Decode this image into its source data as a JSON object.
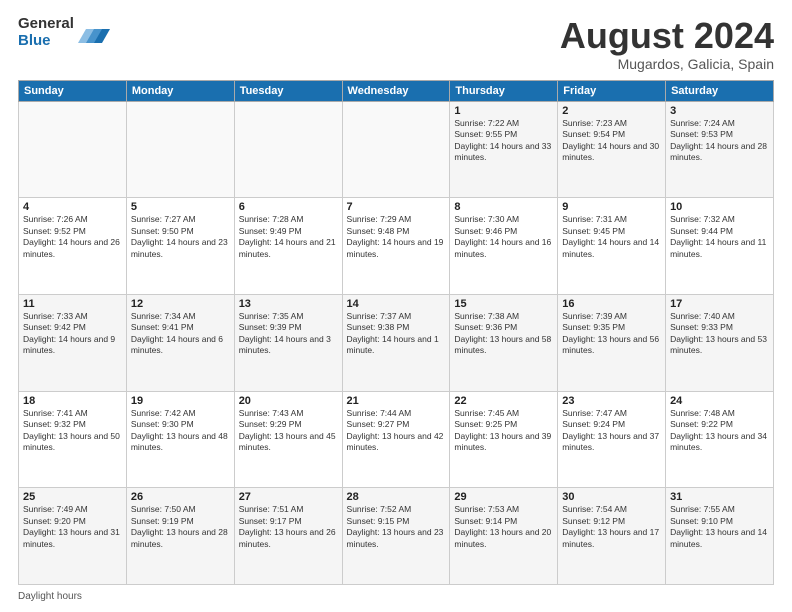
{
  "logo": {
    "general": "General",
    "blue": "Blue"
  },
  "title": "August 2024",
  "subtitle": "Mugardos, Galicia, Spain",
  "weekdays": [
    "Sunday",
    "Monday",
    "Tuesday",
    "Wednesday",
    "Thursday",
    "Friday",
    "Saturday"
  ],
  "weeks": [
    [
      {
        "day": "",
        "info": ""
      },
      {
        "day": "",
        "info": ""
      },
      {
        "day": "",
        "info": ""
      },
      {
        "day": "",
        "info": ""
      },
      {
        "day": "1",
        "info": "Sunrise: 7:22 AM\nSunset: 9:55 PM\nDaylight: 14 hours and 33 minutes."
      },
      {
        "day": "2",
        "info": "Sunrise: 7:23 AM\nSunset: 9:54 PM\nDaylight: 14 hours and 30 minutes."
      },
      {
        "day": "3",
        "info": "Sunrise: 7:24 AM\nSunset: 9:53 PM\nDaylight: 14 hours and 28 minutes."
      }
    ],
    [
      {
        "day": "4",
        "info": "Sunrise: 7:26 AM\nSunset: 9:52 PM\nDaylight: 14 hours and 26 minutes."
      },
      {
        "day": "5",
        "info": "Sunrise: 7:27 AM\nSunset: 9:50 PM\nDaylight: 14 hours and 23 minutes."
      },
      {
        "day": "6",
        "info": "Sunrise: 7:28 AM\nSunset: 9:49 PM\nDaylight: 14 hours and 21 minutes."
      },
      {
        "day": "7",
        "info": "Sunrise: 7:29 AM\nSunset: 9:48 PM\nDaylight: 14 hours and 19 minutes."
      },
      {
        "day": "8",
        "info": "Sunrise: 7:30 AM\nSunset: 9:46 PM\nDaylight: 14 hours and 16 minutes."
      },
      {
        "day": "9",
        "info": "Sunrise: 7:31 AM\nSunset: 9:45 PM\nDaylight: 14 hours and 14 minutes."
      },
      {
        "day": "10",
        "info": "Sunrise: 7:32 AM\nSunset: 9:44 PM\nDaylight: 14 hours and 11 minutes."
      }
    ],
    [
      {
        "day": "11",
        "info": "Sunrise: 7:33 AM\nSunset: 9:42 PM\nDaylight: 14 hours and 9 minutes."
      },
      {
        "day": "12",
        "info": "Sunrise: 7:34 AM\nSunset: 9:41 PM\nDaylight: 14 hours and 6 minutes."
      },
      {
        "day": "13",
        "info": "Sunrise: 7:35 AM\nSunset: 9:39 PM\nDaylight: 14 hours and 3 minutes."
      },
      {
        "day": "14",
        "info": "Sunrise: 7:37 AM\nSunset: 9:38 PM\nDaylight: 14 hours and 1 minute."
      },
      {
        "day": "15",
        "info": "Sunrise: 7:38 AM\nSunset: 9:36 PM\nDaylight: 13 hours and 58 minutes."
      },
      {
        "day": "16",
        "info": "Sunrise: 7:39 AM\nSunset: 9:35 PM\nDaylight: 13 hours and 56 minutes."
      },
      {
        "day": "17",
        "info": "Sunrise: 7:40 AM\nSunset: 9:33 PM\nDaylight: 13 hours and 53 minutes."
      }
    ],
    [
      {
        "day": "18",
        "info": "Sunrise: 7:41 AM\nSunset: 9:32 PM\nDaylight: 13 hours and 50 minutes."
      },
      {
        "day": "19",
        "info": "Sunrise: 7:42 AM\nSunset: 9:30 PM\nDaylight: 13 hours and 48 minutes."
      },
      {
        "day": "20",
        "info": "Sunrise: 7:43 AM\nSunset: 9:29 PM\nDaylight: 13 hours and 45 minutes."
      },
      {
        "day": "21",
        "info": "Sunrise: 7:44 AM\nSunset: 9:27 PM\nDaylight: 13 hours and 42 minutes."
      },
      {
        "day": "22",
        "info": "Sunrise: 7:45 AM\nSunset: 9:25 PM\nDaylight: 13 hours and 39 minutes."
      },
      {
        "day": "23",
        "info": "Sunrise: 7:47 AM\nSunset: 9:24 PM\nDaylight: 13 hours and 37 minutes."
      },
      {
        "day": "24",
        "info": "Sunrise: 7:48 AM\nSunset: 9:22 PM\nDaylight: 13 hours and 34 minutes."
      }
    ],
    [
      {
        "day": "25",
        "info": "Sunrise: 7:49 AM\nSunset: 9:20 PM\nDaylight: 13 hours and 31 minutes."
      },
      {
        "day": "26",
        "info": "Sunrise: 7:50 AM\nSunset: 9:19 PM\nDaylight: 13 hours and 28 minutes."
      },
      {
        "day": "27",
        "info": "Sunrise: 7:51 AM\nSunset: 9:17 PM\nDaylight: 13 hours and 26 minutes."
      },
      {
        "day": "28",
        "info": "Sunrise: 7:52 AM\nSunset: 9:15 PM\nDaylight: 13 hours and 23 minutes."
      },
      {
        "day": "29",
        "info": "Sunrise: 7:53 AM\nSunset: 9:14 PM\nDaylight: 13 hours and 20 minutes."
      },
      {
        "day": "30",
        "info": "Sunrise: 7:54 AM\nSunset: 9:12 PM\nDaylight: 13 hours and 17 minutes."
      },
      {
        "day": "31",
        "info": "Sunrise: 7:55 AM\nSunset: 9:10 PM\nDaylight: 13 hours and 14 minutes."
      }
    ]
  ],
  "footer": "Daylight hours"
}
